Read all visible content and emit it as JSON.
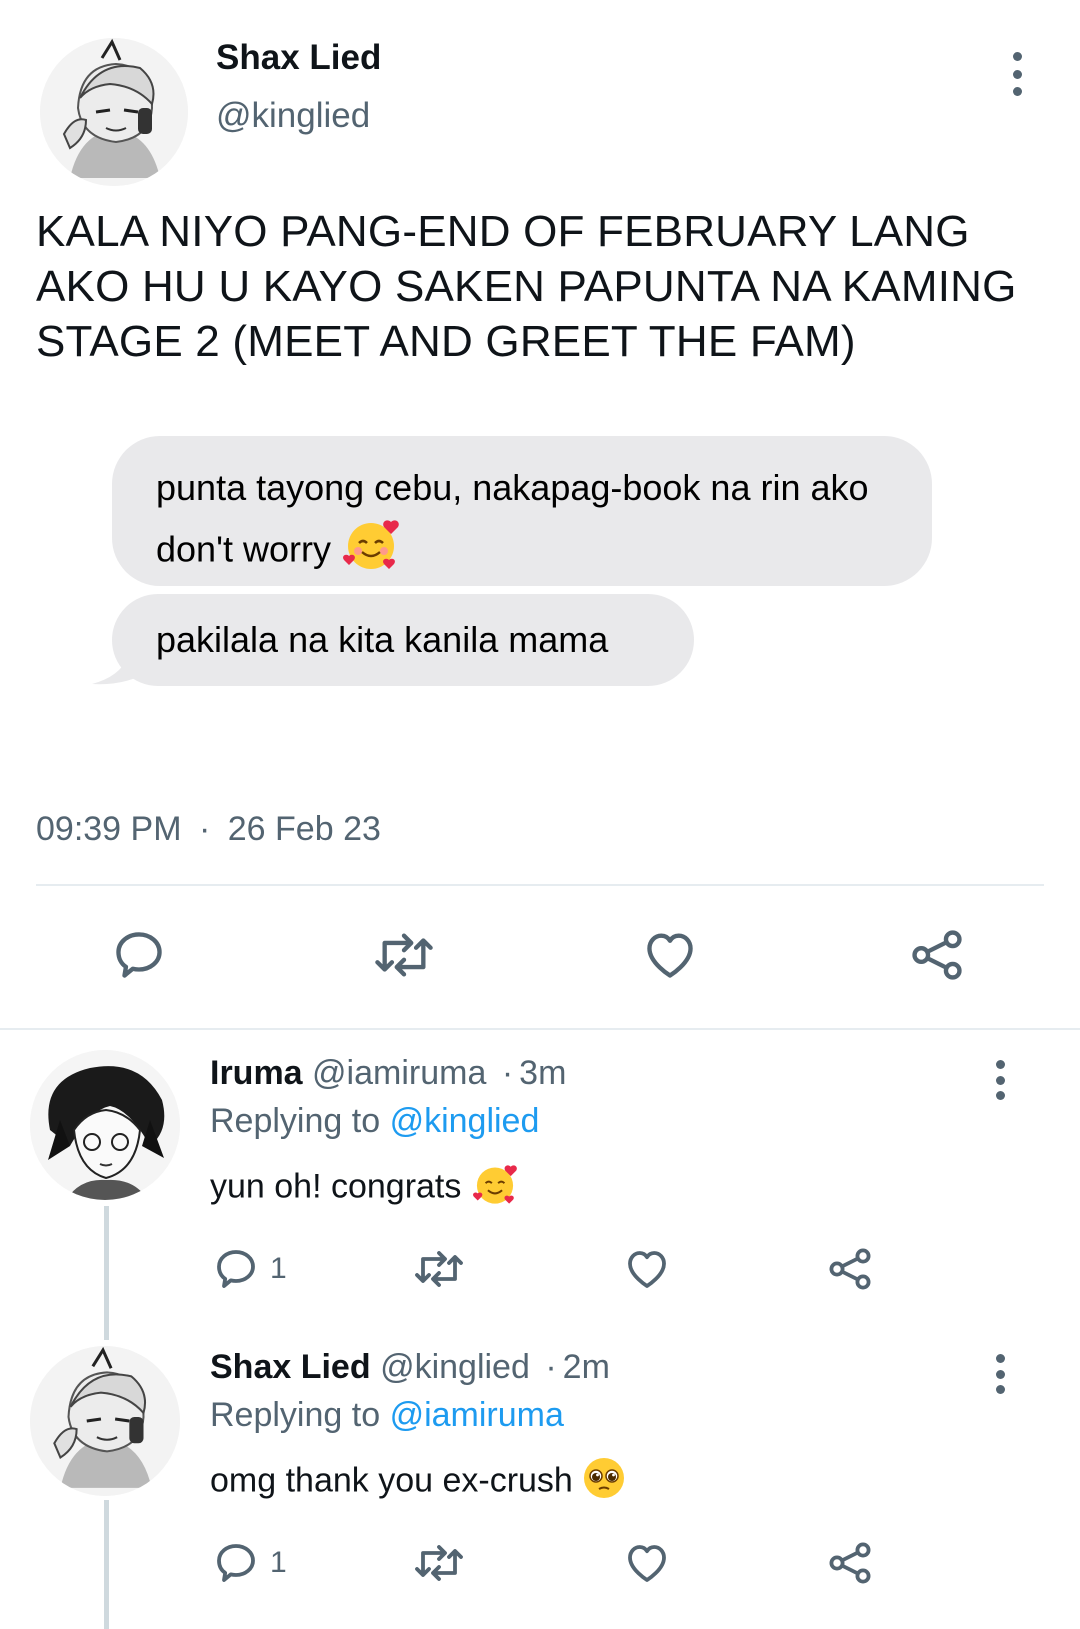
{
  "main_tweet": {
    "name": "Shax Lied",
    "handle": "@kinglied",
    "text": "KALA NIYO PANG-END OF FEBRUARY LANG AKO HU U KAYO SAKEN PAPUNTA NA KAMING STAGE 2 (MEET AND GREET THE FAM)",
    "time": "09:39 PM",
    "separator": "·",
    "date": "26 Feb 23"
  },
  "chat": {
    "bubble_1": "punta tayong cebu, nakapag-book na rin ako don't worry",
    "bubble_2": "pakilala na kita kanila mama"
  },
  "replies": [
    {
      "name": "Iruma",
      "handle": "@iamiruma",
      "separator": "·",
      "age": "3m",
      "replying_label": "Replying to",
      "replying_to": "@kinglied",
      "text": "yun oh! congrats",
      "reply_count": "1"
    },
    {
      "name": "Shax Lied",
      "handle": "@kinglied",
      "separator": "·",
      "age": "2m",
      "replying_label": "Replying to",
      "replying_to": "@iamiruma",
      "text": "omg thank you ex-crush",
      "reply_count": "1"
    }
  ],
  "icons": {
    "reply": "reply-icon",
    "retweet": "retweet-icon",
    "like": "like-icon",
    "share": "share-icon",
    "more": "more-icon"
  },
  "colors": {
    "mention": "#1d9bf0",
    "secondary_text": "#536471",
    "bubble": "#e9e9eb"
  }
}
